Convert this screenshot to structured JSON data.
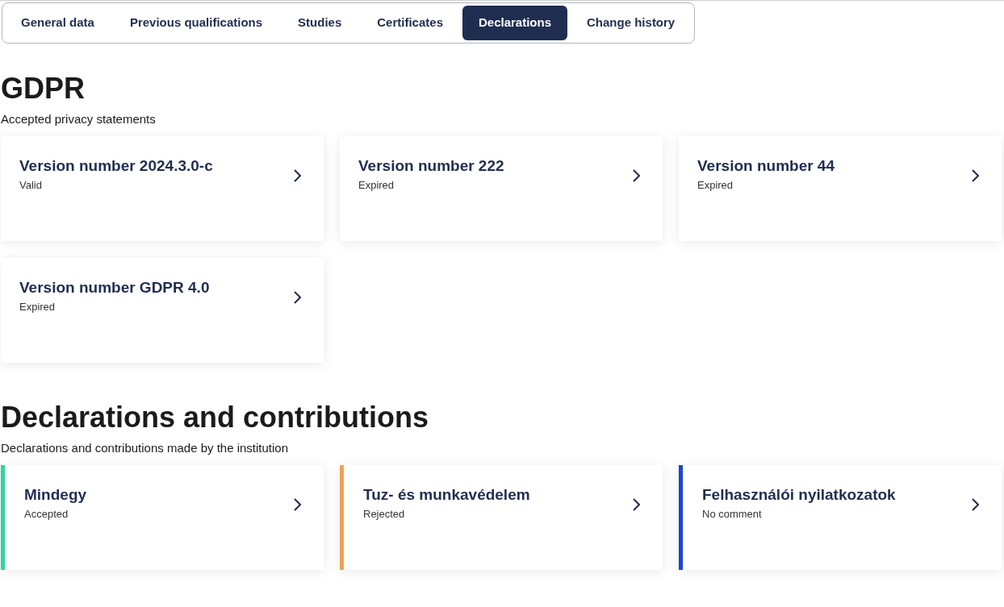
{
  "tabs": [
    {
      "label": "General data",
      "selected": false
    },
    {
      "label": "Previous qualifications",
      "selected": false
    },
    {
      "label": "Studies",
      "selected": false
    },
    {
      "label": "Certificates",
      "selected": false
    },
    {
      "label": "Declarations",
      "selected": true
    },
    {
      "label": "Change history",
      "selected": false
    }
  ],
  "sections": [
    {
      "title": "GDPR",
      "subtitle": "Accepted privacy statements",
      "cards": [
        {
          "title": "Version number 2024.3.0-c",
          "status": "Valid"
        },
        {
          "title": "Version number 222",
          "status": "Expired"
        },
        {
          "title": "Version number 44",
          "status": "Expired"
        },
        {
          "title": "Version number GDPR 4.0",
          "status": "Expired"
        }
      ]
    },
    {
      "title": "Declarations and contributions",
      "subtitle": "Declarations and contributions made by the institution",
      "cards": [
        {
          "title": "Mindegy",
          "status": "Accepted",
          "color": "#2ed6a0"
        },
        {
          "title": "Tuz- és munkavédelem",
          "status": "Rejected",
          "color": "#f0a252"
        },
        {
          "title": "Felhasználói nyilatkozatok",
          "status": "No comment",
          "color": "#1a44d6"
        }
      ]
    }
  ]
}
